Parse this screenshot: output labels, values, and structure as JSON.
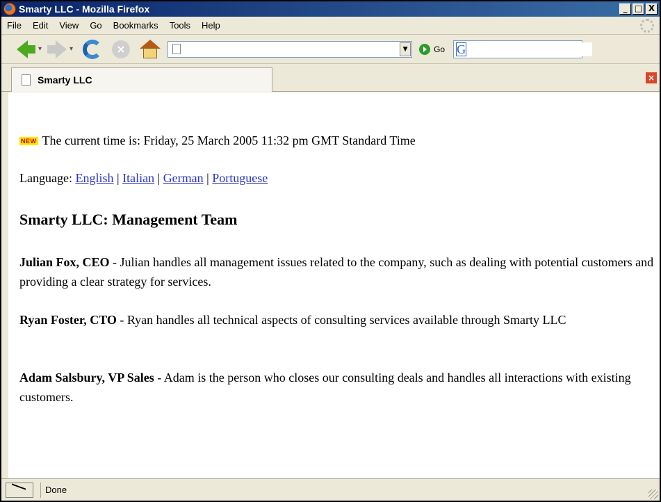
{
  "window": {
    "title": "Smarty LLC - Mozilla Firefox",
    "controls": {
      "minimize": "_",
      "maximize": "□",
      "close": "X"
    }
  },
  "menu": [
    "File",
    "Edit",
    "View",
    "Go",
    "Bookmarks",
    "Tools",
    "Help"
  ],
  "toolbar": {
    "url_value": "",
    "go_label": "Go",
    "search_value": "",
    "icons": [
      "back-arrow-icon",
      "forward-arrow-icon",
      "reload-icon",
      "stop-icon",
      "home-icon",
      "go-icon",
      "google-icon"
    ]
  },
  "tab": {
    "label": "Smarty LLC"
  },
  "page": {
    "new_badge": "NEW",
    "time_text": "The current time is: Friday, 25 March 2005 11:32 pm GMT Standard Time",
    "language_label": "Language:",
    "languages": [
      "English",
      "Italian",
      "German",
      "Portuguese"
    ],
    "heading": "Smarty LLC: Management Team",
    "team": [
      {
        "name": "Julian Fox, CEO",
        "desc": " - Julian handles all management issues related to the company, such as dealing with potential customers and providing a clear strategy for services."
      },
      {
        "name": "Ryan Foster, CTO",
        "desc": " - Ryan handles all technical aspects of consulting services available through Smarty LLC"
      },
      {
        "name": "Adam Salsbury, VP Sales",
        "desc": " - Adam is the person who closes our consulting deals and handles all interactions with existing customers."
      }
    ]
  },
  "status": {
    "text": "Done"
  }
}
